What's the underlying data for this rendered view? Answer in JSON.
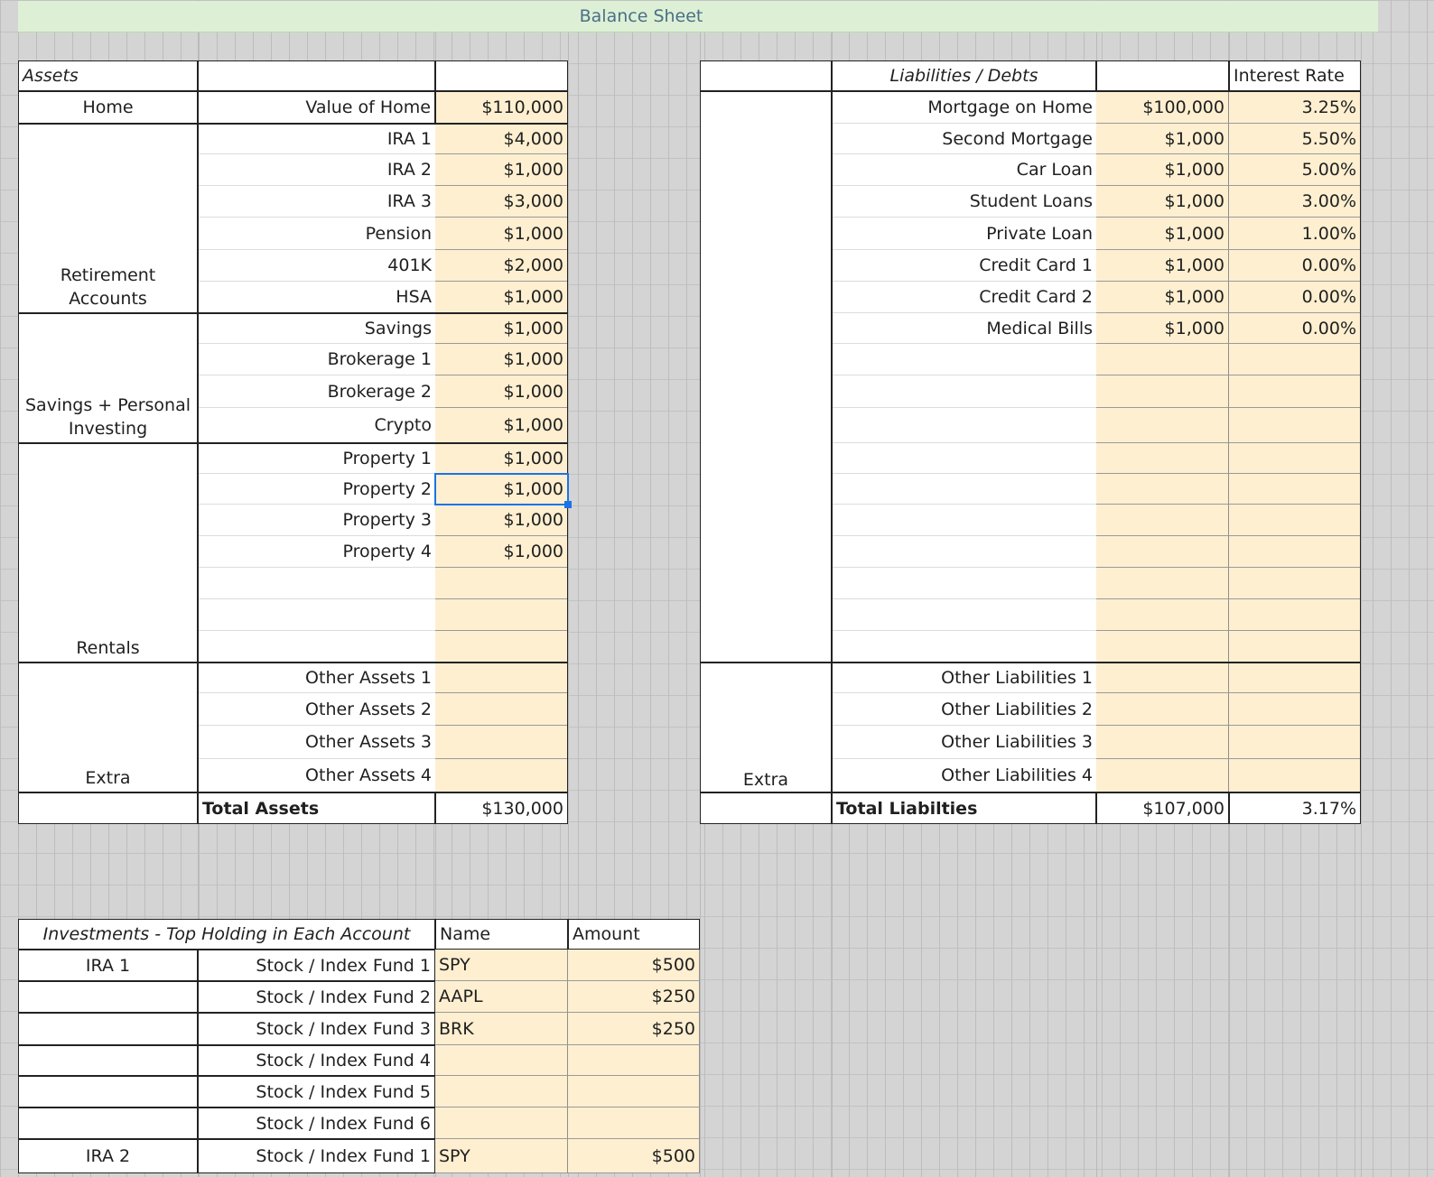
{
  "sheet": {
    "title": "Balance Sheet"
  },
  "assets": {
    "header": "Assets",
    "home": {
      "group": "Home",
      "label": "Value of Home",
      "value": "$110,000"
    },
    "retirement": {
      "group": "Retirement Accounts",
      "rows": [
        {
          "label": "IRA 1",
          "value": "$4,000"
        },
        {
          "label": "IRA 2",
          "value": "$1,000"
        },
        {
          "label": "IRA 3",
          "value": "$3,000"
        },
        {
          "label": "Pension",
          "value": "$1,000"
        },
        {
          "label": "401K",
          "value": "$2,000"
        },
        {
          "label": "HSA",
          "value": "$1,000"
        }
      ]
    },
    "savings": {
      "group": "Savings + Personal Investing",
      "rows": [
        {
          "label": "Savings",
          "value": "$1,000"
        },
        {
          "label": "Brokerage 1",
          "value": "$1,000"
        },
        {
          "label": "Brokerage 2",
          "value": "$1,000"
        },
        {
          "label": "Crypto",
          "value": "$1,000"
        }
      ]
    },
    "rentals": {
      "group": "Rentals",
      "rows": [
        {
          "label": "Property 1",
          "value": "$1,000"
        },
        {
          "label": "Property 2",
          "value": "$1,000"
        },
        {
          "label": "Property 3",
          "value": "$1,000"
        },
        {
          "label": "Property 4",
          "value": "$1,000"
        },
        {
          "label": "",
          "value": ""
        },
        {
          "label": "",
          "value": ""
        },
        {
          "label": "",
          "value": ""
        }
      ]
    },
    "extra": {
      "group": "Extra",
      "rows": [
        {
          "label": "Other Assets 1",
          "value": ""
        },
        {
          "label": "Other Assets 2",
          "value": ""
        },
        {
          "label": "Other Assets 3",
          "value": ""
        },
        {
          "label": "Other Assets 4",
          "value": ""
        }
      ]
    },
    "total": {
      "label": "Total Assets",
      "value": "$130,000"
    }
  },
  "liabilities": {
    "header": "Liabilities / Debts",
    "rate_header": "Interest Rate",
    "rows": [
      {
        "label": "Mortgage on Home",
        "value": "$100,000",
        "rate": "3.25%"
      },
      {
        "label": "Second Mortgage",
        "value": "$1,000",
        "rate": "5.50%"
      },
      {
        "label": "Car Loan",
        "value": "$1,000",
        "rate": "5.00%"
      },
      {
        "label": "Student Loans",
        "value": "$1,000",
        "rate": "3.00%"
      },
      {
        "label": "Private Loan",
        "value": "$1,000",
        "rate": "1.00%"
      },
      {
        "label": "Credit Card 1",
        "value": "$1,000",
        "rate": "0.00%"
      },
      {
        "label": "Credit Card 2",
        "value": "$1,000",
        "rate": "0.00%"
      },
      {
        "label": "Medical Bills",
        "value": "$1,000",
        "rate": "0.00%"
      },
      {
        "label": "",
        "value": "",
        "rate": ""
      },
      {
        "label": "",
        "value": "",
        "rate": ""
      },
      {
        "label": "",
        "value": "",
        "rate": ""
      },
      {
        "label": "",
        "value": "",
        "rate": ""
      },
      {
        "label": "",
        "value": "",
        "rate": ""
      },
      {
        "label": "",
        "value": "",
        "rate": ""
      },
      {
        "label": "",
        "value": "",
        "rate": ""
      },
      {
        "label": "",
        "value": "",
        "rate": ""
      },
      {
        "label": "",
        "value": "",
        "rate": ""
      },
      {
        "label": "",
        "value": "",
        "rate": ""
      }
    ],
    "extra": {
      "group": "Extra",
      "rows": [
        {
          "label": "Other Liabilities 1",
          "value": "",
          "rate": ""
        },
        {
          "label": "Other Liabilities 2",
          "value": "",
          "rate": ""
        },
        {
          "label": "Other Liabilities 3",
          "value": "",
          "rate": ""
        },
        {
          "label": "Other Liabilities 4",
          "value": "",
          "rate": ""
        }
      ]
    },
    "total": {
      "label": "Total Liabilties",
      "value": "$107,000",
      "rate": "3.17%"
    }
  },
  "investments": {
    "header": "Investments - Top Holding in Each Account",
    "name_header": "Name",
    "amount_header": "Amount",
    "rows": [
      {
        "account": "IRA 1",
        "label": "Stock / Index Fund 1",
        "name": "SPY",
        "amount": "$500"
      },
      {
        "account": "",
        "label": "Stock / Index Fund 2",
        "name": "AAPL",
        "amount": "$250"
      },
      {
        "account": "",
        "label": "Stock / Index Fund 3",
        "name": "BRK",
        "amount": "$250"
      },
      {
        "account": "",
        "label": "Stock / Index Fund 4",
        "name": "",
        "amount": ""
      },
      {
        "account": "",
        "label": "Stock / Index Fund 5",
        "name": "",
        "amount": ""
      },
      {
        "account": "",
        "label": "Stock / Index Fund 6",
        "name": "",
        "amount": ""
      },
      {
        "account": "IRA 2",
        "label": "Stock / Index Fund 1",
        "name": "SPY",
        "amount": "$500"
      }
    ]
  },
  "selection": {
    "cell": "assets.rentals.rows.1.value"
  }
}
